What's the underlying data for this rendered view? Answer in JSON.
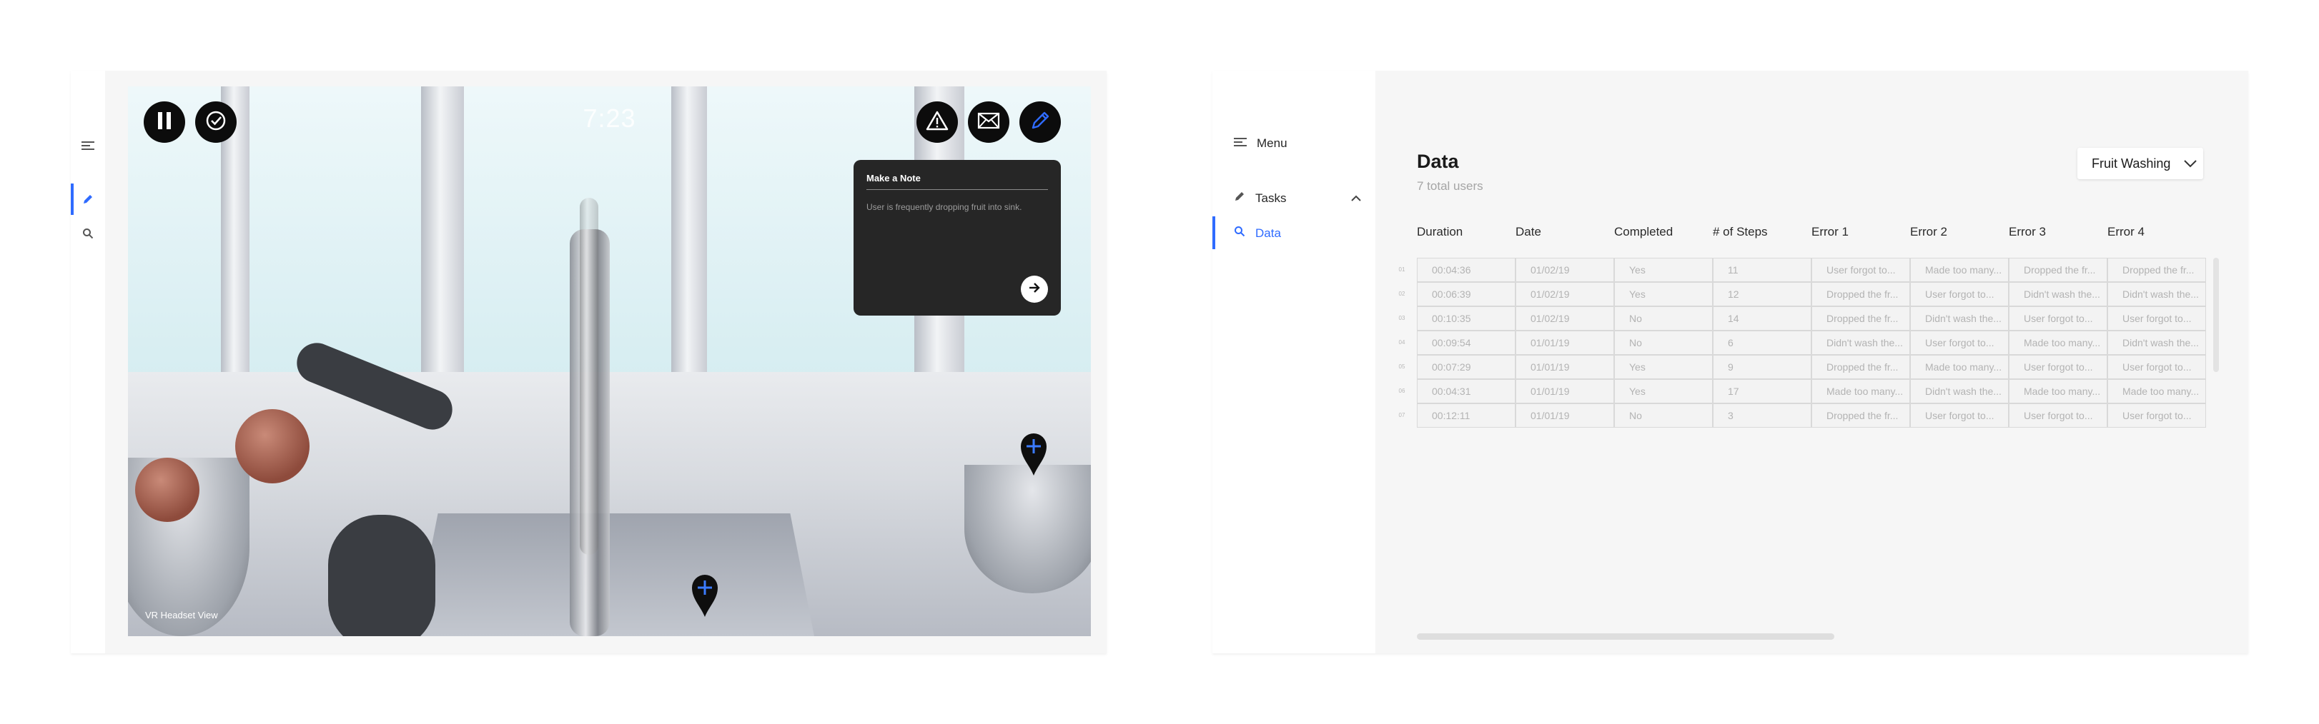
{
  "vr": {
    "timer": "7:23",
    "view_label": "VR Headset View",
    "icons": {
      "pause": "pause-icon",
      "check": "check-circle-icon",
      "warning": "warning-icon",
      "mail": "mail-icon",
      "pencil": "pencil-icon"
    },
    "note": {
      "title": "Make a Note",
      "body": "User is frequently dropping fruit into sink."
    }
  },
  "data_view": {
    "nav": {
      "menu_label": "Menu",
      "tasks_label": "Tasks",
      "data_label": "Data"
    },
    "title": "Data",
    "subtitle": "7 total users",
    "dataset": "Fruit Washing",
    "columns": [
      "Duration",
      "Date",
      "Completed",
      "# of Steps",
      "Error 1",
      "Error 2",
      "Error 3",
      "Error 4"
    ],
    "rows": [
      {
        "idx": "01",
        "cells": [
          "00:04:36",
          "01/02/19",
          "Yes",
          "11",
          "User forgot to...",
          "Made too many...",
          "Dropped the fr...",
          "Dropped the fr..."
        ]
      },
      {
        "idx": "02",
        "cells": [
          "00:06:39",
          "01/02/19",
          "Yes",
          "12",
          "Dropped the fr...",
          "User forgot to...",
          "Didn't wash the...",
          "Didn't wash the..."
        ]
      },
      {
        "idx": "03",
        "cells": [
          "00:10:35",
          "01/02/19",
          "No",
          "14",
          "Dropped the fr...",
          "Didn't wash the...",
          "User forgot to...",
          "User forgot to..."
        ]
      },
      {
        "idx": "04",
        "cells": [
          "00:09:54",
          "01/01/19",
          "No",
          "6",
          "Didn't wash the...",
          "User forgot to...",
          "Made too many...",
          "Didn't wash the..."
        ]
      },
      {
        "idx": "05",
        "cells": [
          "00:07:29",
          "01/01/19",
          "Yes",
          "9",
          "Dropped the fr...",
          "Made too many...",
          "User forgot to...",
          "User forgot to..."
        ]
      },
      {
        "idx": "06",
        "cells": [
          "00:04:31",
          "01/01/19",
          "Yes",
          "17",
          "Made too many...",
          "Didn't wash the...",
          "Made too many...",
          "Made too many..."
        ]
      },
      {
        "idx": "07",
        "cells": [
          "00:12:11",
          "01/01/19",
          "No",
          "3",
          "Dropped the fr...",
          "User forgot to...",
          "User forgot to...",
          "User forgot to..."
        ]
      }
    ]
  },
  "colors": {
    "accent": "#2f6bff",
    "note_bg": "#262626",
    "button_bg": "#0c0c0c"
  }
}
